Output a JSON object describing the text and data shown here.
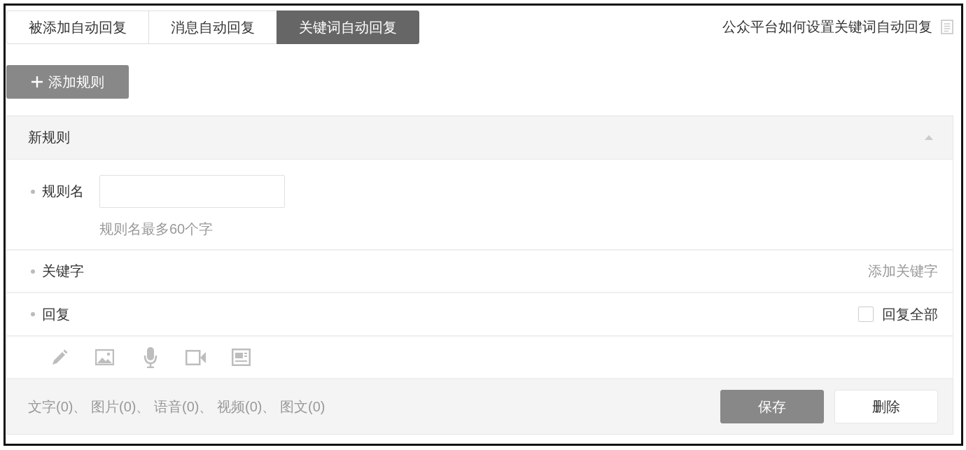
{
  "tabs": [
    {
      "label": "被添加自动回复",
      "selected": false
    },
    {
      "label": "消息自动回复",
      "selected": false
    },
    {
      "label": "关键词自动回复",
      "selected": true
    }
  ],
  "help_link": {
    "label": "公众平台如何设置关键词自动回复"
  },
  "add_rule_button": {
    "label": "添加规则"
  },
  "rule": {
    "title": "新规则",
    "expanded": true,
    "name_field": {
      "label": "规则名",
      "hint": "规则名最多60个字"
    },
    "keyword_field": {
      "label": "关键字",
      "action": "添加关键字"
    },
    "reply_field": {
      "label": "回复",
      "reply_all": {
        "label": "回复全部",
        "checked": false
      }
    },
    "summary": "文字(0)、 图片(0)、 语音(0)、 视频(0)、 图文(0)",
    "buttons": [
      {
        "label": "保存",
        "kind": "primary"
      },
      {
        "label": "删除",
        "kind": "secondary"
      }
    ]
  }
}
